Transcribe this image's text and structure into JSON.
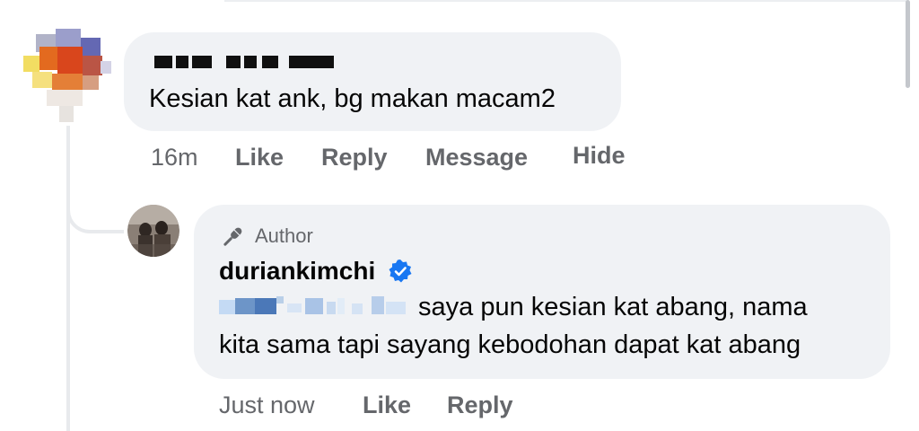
{
  "comment": {
    "text": "Kesian kat ank, bg makan macam2",
    "time": "16m",
    "actions": [
      "Like",
      "Reply",
      "Message",
      "Hide"
    ]
  },
  "reply": {
    "badge": "Author",
    "username": "duriankimchi",
    "text_line1": "saya pun kesian kat abang, nama",
    "text_line2": "kita sama tapi sayang kebodohan dapat kat abang",
    "time": "Just now",
    "actions": [
      "Like",
      "Reply"
    ]
  },
  "colors": {
    "bubble": "#f0f2f5",
    "meta_text": "#65676b",
    "verified": "#1877f2"
  },
  "icons": [
    "microphone-icon",
    "verified-badge-icon"
  ]
}
